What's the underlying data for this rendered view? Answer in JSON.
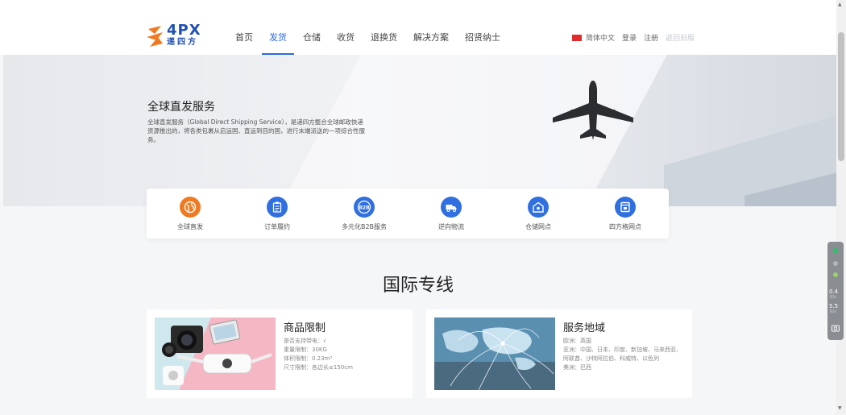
{
  "brand": {
    "logo_text": "4PX",
    "logo_sub": "递四方",
    "logo_color": "#1f4fb5"
  },
  "nav": {
    "items": [
      {
        "label": "首页",
        "active": false
      },
      {
        "label": "发货",
        "active": true
      },
      {
        "label": "仓储",
        "active": false
      },
      {
        "label": "收货",
        "active": false
      },
      {
        "label": "退换货",
        "active": false
      },
      {
        "label": "解决方案",
        "active": false
      },
      {
        "label": "招贤纳士",
        "active": false
      }
    ],
    "active_color": "#2c6bde"
  },
  "header_right": {
    "language": "简体中文",
    "login": "登录",
    "register": "注册",
    "old_version": "返回旧版"
  },
  "banner": {
    "title": "全球直发服务",
    "description": "全球直发服务（Global Direct Shipping Service），是递四方整合全球邮政快递资源推出的，将各类包裹从启运国、直运到目的国，进行末端派送的一项综合性服务。"
  },
  "services": [
    {
      "label": "全球直发",
      "icon": "globe-icon",
      "color": "#ef7a22"
    },
    {
      "label": "订单履约",
      "icon": "clipboard-icon",
      "color": "#2f6fe0"
    },
    {
      "label": "多元化B2B服务",
      "icon": "b2b-icon",
      "color": "#2f6fe0"
    },
    {
      "label": "逆向物流",
      "icon": "truck-icon",
      "color": "#2f6fe0"
    },
    {
      "label": "仓储网点",
      "icon": "warehouse-icon",
      "color": "#2f6fe0"
    },
    {
      "label": "四方格网点",
      "icon": "locker-icon",
      "color": "#2f6fe0"
    }
  ],
  "section_title": "国际专线",
  "cards": {
    "product_limits": {
      "title": "商品限制",
      "lines": [
        "是否支持带电：√",
        "重量限制：30KG",
        "体积限制：0.23m³",
        "尺寸限制：各边长≤150cm"
      ]
    },
    "service_area": {
      "title": "服务地域",
      "lines": [
        "欧洲：英国",
        "亚洲：中国、日本、印度、新加坡、马来西亚、阿联酋、沙特阿拉伯、科威特、以色列",
        "美洲：巴西"
      ]
    }
  },
  "monitor_widget": {
    "value1": "0.4",
    "unit1": "K/s",
    "value2": "5.5",
    "unit2": "K/s"
  }
}
